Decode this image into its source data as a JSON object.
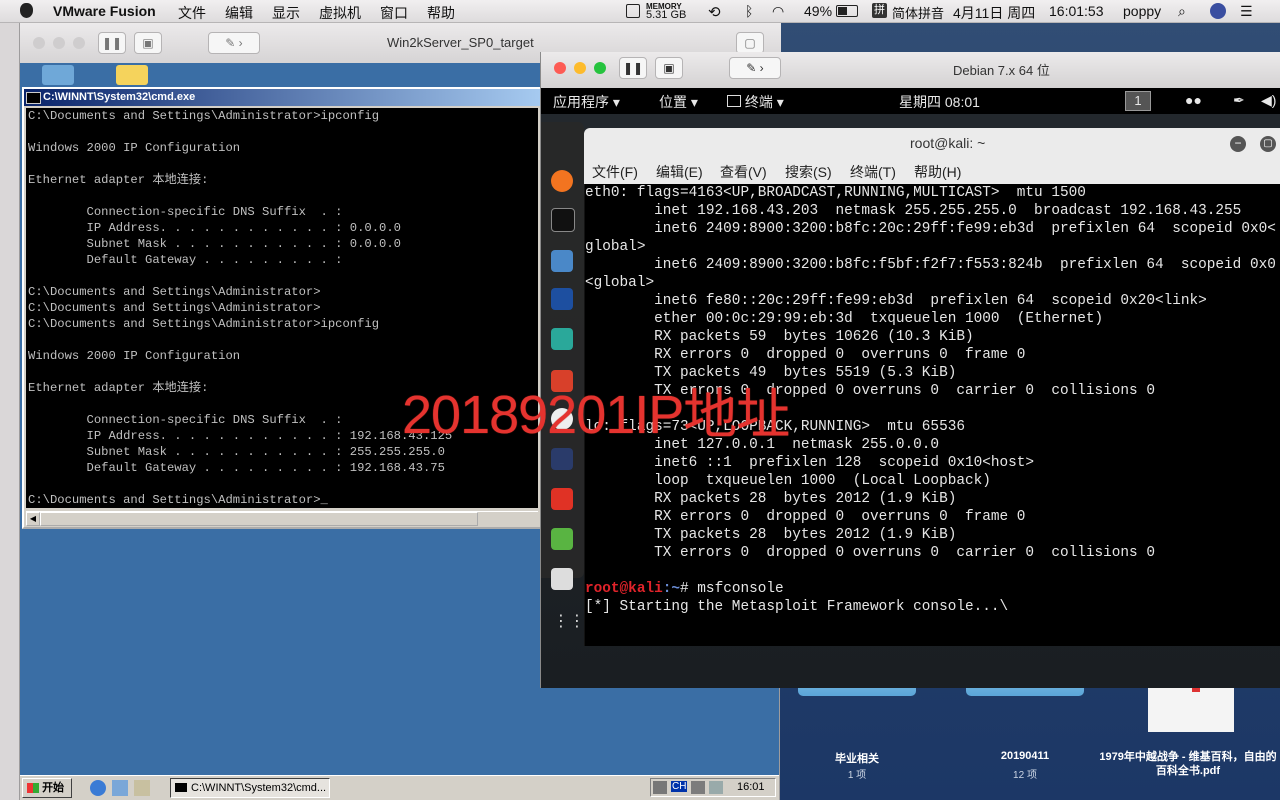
{
  "menubar": {
    "app_name": "VMware Fusion",
    "menus": [
      "文件",
      "编辑",
      "显示",
      "虚拟机",
      "窗口",
      "帮助"
    ],
    "memory_label": "MEMORY",
    "memory_value": "5.31 GB",
    "battery": "49%",
    "input_method": "简体拼音",
    "date": "4月11日 周四",
    "time": "16:01:53",
    "user": "poppy"
  },
  "vm1": {
    "title": "Win2kServer_SP0_target",
    "cmd_title": "C:\\WINNT\\System32\\cmd.exe",
    "cmd_lines": [
      "C:\\Documents and Settings\\Administrator>ipconfig",
      "",
      "Windows 2000 IP Configuration",
      "",
      "Ethernet adapter 本地连接:",
      "",
      "        Connection-specific DNS Suffix  . :",
      "        IP Address. . . . . . . . . . . . : 0.0.0.0",
      "        Subnet Mask . . . . . . . . . . . : 0.0.0.0",
      "        Default Gateway . . . . . . . . . :",
      "",
      "C:\\Documents and Settings\\Administrator>",
      "C:\\Documents and Settings\\Administrator>",
      "C:\\Documents and Settings\\Administrator>ipconfig",
      "",
      "Windows 2000 IP Configuration",
      "",
      "Ethernet adapter 本地连接:",
      "",
      "        Connection-specific DNS Suffix  . :",
      "        IP Address. . . . . . . . . . . . : 192.168.43.125",
      "        Subnet Mask . . . . . . . . . . . : 255.255.255.0",
      "        Default Gateway . . . . . . . . . : 192.168.43.75",
      "",
      "C:\\Documents and Settings\\Administrator>_"
    ],
    "taskbar": {
      "start": "开始",
      "task": "C:\\WINNT\\System32\\cmd...",
      "tray_lang": "CH",
      "clock": "16:01"
    }
  },
  "vm2": {
    "title": "Debian 7.x 64 位",
    "gnome": {
      "apps": "应用程序",
      "places": "位置",
      "terminal": "终端",
      "clock": "星期四 08:01",
      "workspace": "1"
    },
    "terminal_title": "root@kali: ~",
    "terminal_menu": [
      "文件(F)",
      "编辑(E)",
      "查看(V)",
      "搜索(S)",
      "终端(T)",
      "帮助(H)"
    ],
    "lines": [
      "eth0: flags=4163<UP,BROADCAST,RUNNING,MULTICAST>  mtu 1500",
      "        inet 192.168.43.203  netmask 255.255.255.0  broadcast 192.168.43.255",
      "        inet6 2409:8900:3200:b8fc:20c:29ff:fe99:eb3d  prefixlen 64  scopeid 0x0<",
      "global>",
      "        inet6 2409:8900:3200:b8fc:f5bf:f2f7:f553:824b  prefixlen 64  scopeid 0x0",
      "<global>",
      "        inet6 fe80::20c:29ff:fe99:eb3d  prefixlen 64  scopeid 0x20<link>",
      "        ether 00:0c:29:99:eb:3d  txqueuelen 1000  (Ethernet)",
      "        RX packets 59  bytes 10626 (10.3 KiB)",
      "        RX errors 0  dropped 0  overruns 0  frame 0",
      "        TX packets 49  bytes 5519 (5.3 KiB)",
      "        TX errors 0  dropped 0 overruns 0  carrier 0  collisions 0",
      "",
      "lo: flags=73<UP,LOOPBACK,RUNNING>  mtu 65536",
      "        inet 127.0.0.1  netmask 255.0.0.0",
      "        inet6 ::1  prefixlen 128  scopeid 0x10<host>",
      "        loop  txqueuelen 1000  (Local Loopback)",
      "        RX packets 28  bytes 2012 (1.9 KiB)",
      "        RX errors 0  dropped 0  overruns 0  frame 0",
      "        TX packets 28  bytes 2012 (1.9 KiB)",
      "        TX errors 0  dropped 0 overruns 0  carrier 0  collisions 0",
      ""
    ],
    "prompt_user": "root@kali",
    "prompt_path": ":~",
    "prompt_symbol": "# ",
    "command": "msfconsole",
    "last_line": "[*] Starting the Metasploit Framework console...\\"
  },
  "overlay_text": "20189201IP地址",
  "mac_desktop": [
    {
      "name": "毕业相关",
      "count": "1 项"
    },
    {
      "name": "20190411",
      "count": "12 项"
    },
    {
      "name": "1979年中越战争 - 维基百科，自由的百科全书.pdf",
      "count": ""
    }
  ],
  "colors": {
    "prompt_red": "#e0232a",
    "prompt_blue": "#6a8dd6",
    "stamp": "#e5332f"
  }
}
